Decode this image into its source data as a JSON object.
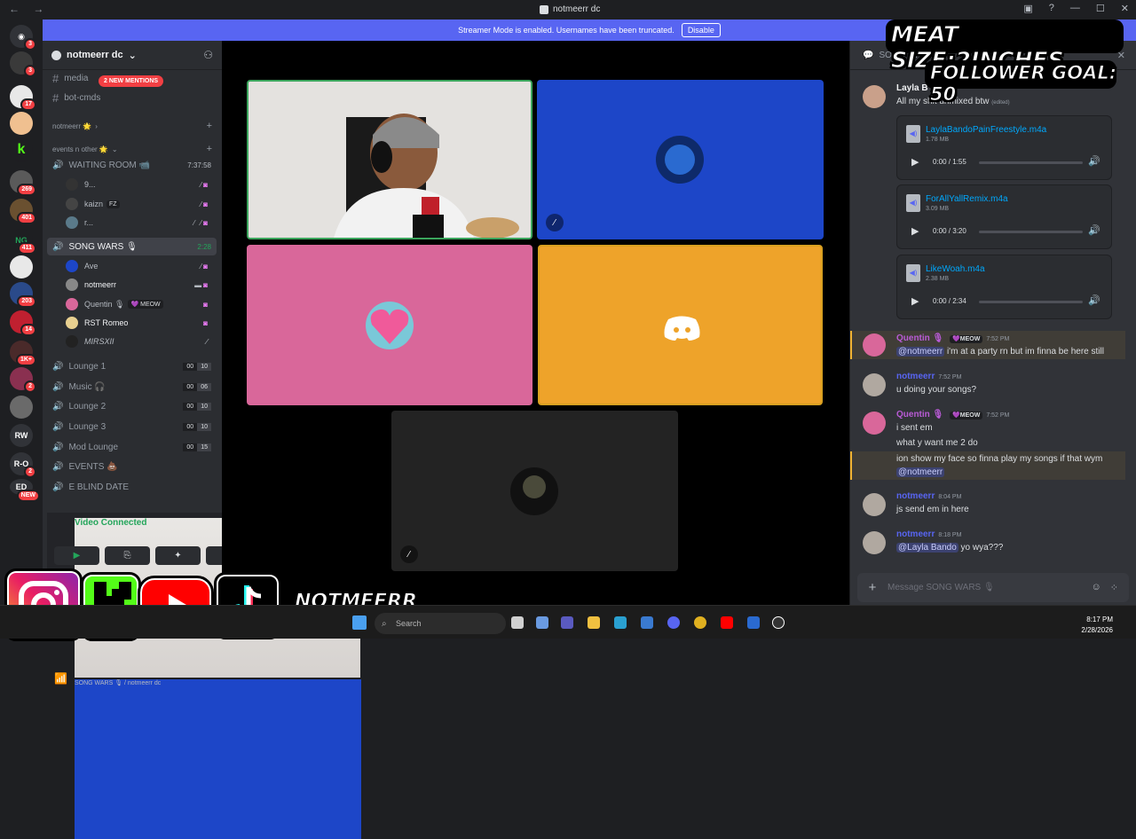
{
  "window": {
    "title": "notmeerr dc",
    "back": "←",
    "forward": "→"
  },
  "banner": {
    "text": "Streamer Mode is enabled. Usernames have been truncated.",
    "button": "Disable"
  },
  "rail": {
    "badges": [
      "3",
      "3",
      "17",
      "",
      "",
      "269",
      "401",
      "411",
      "",
      "203",
      "14",
      "1K+",
      "2",
      "2",
      "",
      "",
      "",
      "NEW"
    ],
    "labels": {
      "rw": "RW",
      "ro": "R-O",
      "ed": "ED"
    }
  },
  "sidebar": {
    "guild_name": "notmeerr dc",
    "mention_pill": "2 NEW MENTIONS",
    "channels": [
      {
        "name": "media"
      },
      {
        "name": "bot-cmds"
      }
    ],
    "categories": [
      {
        "name": "notmeerr 🌟"
      },
      {
        "name": "events n other 🌟"
      }
    ],
    "voice": [
      {
        "name": "WAITING ROOM 📹",
        "timer": "7:37:58"
      },
      {
        "name": "SONG WARS 🎙",
        "timer": "2:28"
      },
      {
        "name": "Lounge 1",
        "a": "00",
        "b": "10"
      },
      {
        "name": "Music 🎧",
        "a": "00",
        "b": "06"
      },
      {
        "name": "Lounge 2",
        "a": "00",
        "b": "10"
      },
      {
        "name": "Lounge 3",
        "a": "00",
        "b": "10"
      },
      {
        "name": "Mod Lounge",
        "a": "00",
        "b": "15"
      },
      {
        "name": "EVENTS 💩"
      },
      {
        "name": "E BLIND DATE"
      }
    ],
    "waiting_users": [
      {
        "name": "9..."
      },
      {
        "name": "kaizn",
        "tag": "FZ"
      },
      {
        "name": "r..."
      }
    ],
    "song_users": [
      {
        "name": "Ave"
      },
      {
        "name": "notmeerr"
      },
      {
        "name": "Quentin 🎙",
        "tag": "💜 MEOW"
      },
      {
        "name": "RST Romeo"
      },
      {
        "name": "MIRSXII"
      }
    ]
  },
  "voice_panel": {
    "status": "Video Connected",
    "sub": "SONG WARS 🎙 / notmeerr dc"
  },
  "chat": {
    "channel": "SONG WARS 🎙",
    "messages": [
      {
        "author": "Layla B",
        "lines": [
          "All my shit unmixed btw"
        ],
        "edited": "(edited)"
      },
      {
        "author": "Quentin 🎙",
        "tag": "💜MEOW",
        "time": "7:52 PM",
        "mention": "@notmeerr",
        "text": "i'm at a party rn but im finna be here still"
      },
      {
        "author": "notmeerr",
        "time": "7:52 PM",
        "text": "u doing your songs?"
      },
      {
        "author": "Quentin 🎙",
        "tag": "💜MEOW",
        "time": "7:52 PM",
        "lines": [
          "i sent em",
          "what y want me 2 do",
          "ion show my face so finna play my songs if that wym"
        ],
        "mention": "@notmeerr"
      },
      {
        "author": "notmeerr",
        "time": "8:04 PM",
        "text": "js send em in here"
      },
      {
        "author": "notmeerr",
        "time": "8:18 PM",
        "mention": "@Layla Bando",
        "text": "yo wya???"
      }
    ],
    "attachments": [
      {
        "name": "LaylaBandoPainFreestyle.m4a",
        "size": "1.78 MB",
        "time": "0:00 / 1:55"
      },
      {
        "name": "ForAllYallRemix.m4a",
        "size": "3.09 MB",
        "time": "0:00 / 3:20"
      },
      {
        "name": "LikeWoah.m4a",
        "size": "2.38 MB",
        "time": "0:00 / 2:34"
      }
    ],
    "composer_placeholder": "Message SONG WARS 🎙"
  },
  "overlay": {
    "meat": "MEAT SIZE:2INCHES",
    "goal": "FOLLOWER GOAL: 50",
    "handle": "NOTMEERR"
  },
  "taskbar": {
    "search": "Search",
    "time": "8:17 PM",
    "date": "2/28/2026"
  },
  "colors": {
    "blurple": "#5865f2",
    "green": "#23a55a",
    "pink": "#d9679a",
    "orange": "#eea32a",
    "blue": "#1d46c8"
  }
}
